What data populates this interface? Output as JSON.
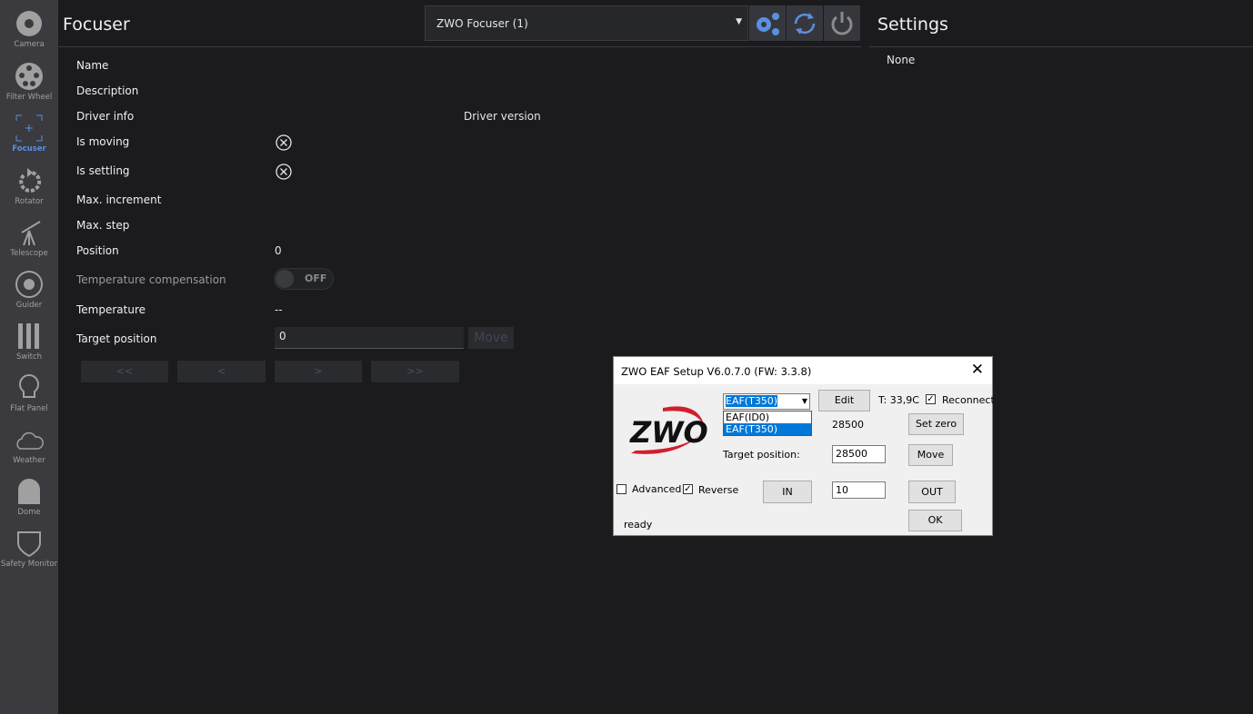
{
  "sidebar": {
    "items": [
      {
        "label": "Camera",
        "icon": "camera-aperture-icon"
      },
      {
        "label": "Filter Wheel",
        "icon": "filter-wheel-icon"
      },
      {
        "label": "Focuser",
        "icon": "focuser-icon",
        "active": true
      },
      {
        "label": "Rotator",
        "icon": "rotator-icon"
      },
      {
        "label": "Telescope",
        "icon": "telescope-icon"
      },
      {
        "label": "Guider",
        "icon": "guider-icon"
      },
      {
        "label": "Switch",
        "icon": "switch-icon"
      },
      {
        "label": "Flat Panel",
        "icon": "lightbulb-icon"
      },
      {
        "label": "Weather",
        "icon": "cloud-icon"
      },
      {
        "label": "Dome",
        "icon": "dome-icon"
      },
      {
        "label": "Safety Monitor",
        "icon": "shield-icon"
      }
    ]
  },
  "header": {
    "title": "Focuser",
    "device": "ZWO Focuser (1)",
    "settings_title": "Settings"
  },
  "settings": {
    "value": "None"
  },
  "props": {
    "name": "Name",
    "description": "Description",
    "driver_info": "Driver info",
    "driver_version": "Driver version",
    "is_moving": "Is moving",
    "is_settling": "Is settling",
    "max_increment": "Max. increment",
    "max_step": "Max. step",
    "position": "Position",
    "position_value": "0",
    "temp_comp": "Temperature compensation",
    "temp_comp_state": "OFF",
    "temperature": "Temperature",
    "temperature_value": "--",
    "target_position": "Target position",
    "target_value": "0",
    "move": "Move"
  },
  "nav_buttons": [
    "<<",
    "<",
    ">",
    ">>"
  ],
  "colors": {
    "accent": "#5b8fe0",
    "sidebar": "#3a3a3f",
    "background": "#1b1b1e"
  },
  "dialog": {
    "title": "ZWO EAF Setup V6.0.7.0 (FW: 3.3.8)",
    "selected": "EAF(T350)",
    "options": [
      "EAF(ID0)",
      "EAF(T350)"
    ],
    "edit": "Edit",
    "temp": "T: 33,9C",
    "reconnect": "Reconnect",
    "position": "28500",
    "set_zero": "Set zero",
    "target_label": "Target position:",
    "target_value": "28500",
    "move": "Move",
    "advanced": "Advanced",
    "reverse": "Reverse",
    "in": "IN",
    "step": "10",
    "out": "OUT",
    "ok": "OK",
    "status": "ready",
    "logo": "ZWO"
  }
}
